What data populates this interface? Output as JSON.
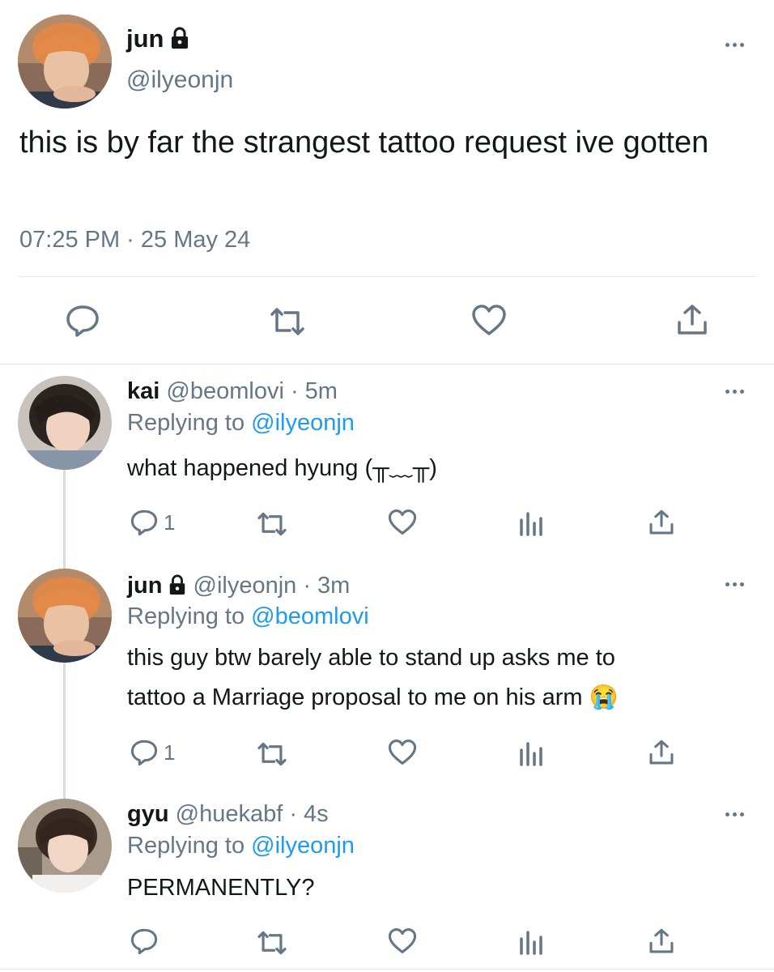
{
  "main_tweet": {
    "name": "jun",
    "handle": "@ilyeonjn",
    "text": "this is by far the strangest tattoo request ive gotten",
    "timestamp": "07:25 PM · 25 May 24"
  },
  "replies": [
    {
      "name": "kai",
      "handle": "@beomlovi",
      "time": "· 5m",
      "replying_prefix": "Replying to",
      "replying_to": "@ilyeonjn",
      "text": "what happened hyung (╥﹏╥)",
      "reply_count": "1"
    },
    {
      "name": "jun",
      "handle": "@ilyeonjn",
      "time": "· 3m",
      "replying_prefix": "Replying to",
      "replying_to": "@beomlovi",
      "text_line1": "this guy btw barely able to stand up asks me to",
      "text_line2": "tattoo a Marriage proposal to me on his arm 😭",
      "reply_count": "1"
    },
    {
      "name": "gyu",
      "handle": "@huekabf",
      "time": "· 4s",
      "replying_prefix": "Replying to",
      "replying_to": "@ilyeonjn",
      "text": "PERMANENTLY?",
      "reply_count": ""
    }
  ],
  "icons": [
    "lock-icon",
    "reply-icon",
    "retweet-icon",
    "like-icon",
    "share-icon",
    "analytics-icon",
    "more-icon"
  ],
  "colors": {
    "link": "#1d9bf0",
    "muted": "#657786",
    "text": "#14171a",
    "divider": "#e1e8ed"
  }
}
